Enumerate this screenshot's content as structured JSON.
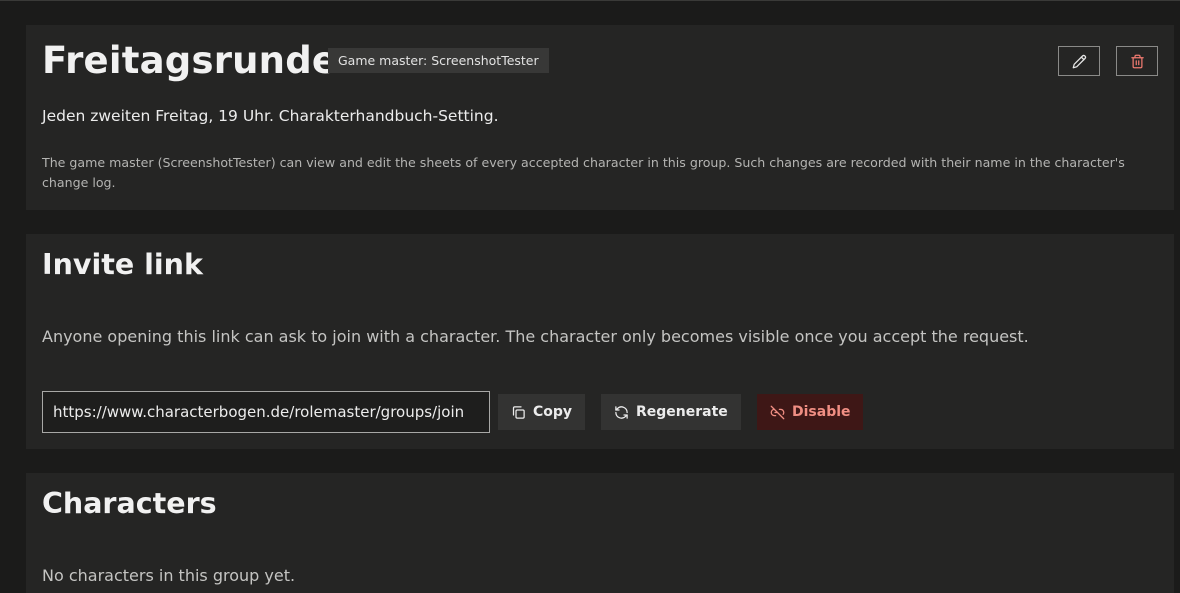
{
  "group": {
    "title": "Freitagsrunde",
    "gm_badge": "Game master: ScreenshotTester",
    "description": "Jeden zweiten Freitag, 19 Uhr. Charakterhandbuch-Setting.",
    "gm_note": "The game master (ScreenshotTester) can view and edit the sheets of every accepted character in this group. Such changes are recorded with their name in the character's change log.",
    "edit_icon": "pencil-icon",
    "delete_icon": "trash-icon"
  },
  "invite": {
    "title": "Invite link",
    "description": "Anyone opening this link can ask to join with a character. The character only becomes visible once you accept the request.",
    "url": "https://www.characterbogen.de/rolemaster/groups/join",
    "copy_label": "Copy",
    "regenerate_label": "Regenerate",
    "disable_label": "Disable",
    "copy_icon": "copy-icon",
    "regenerate_icon": "refresh-icon",
    "disable_icon": "link-off-icon"
  },
  "characters": {
    "title": "Characters",
    "empty_text": "No characters in this group yet."
  },
  "colors": {
    "background": "#1b1b1a",
    "card": "#252524",
    "danger_bg": "#3e1716",
    "danger_text": "#f08e83"
  }
}
